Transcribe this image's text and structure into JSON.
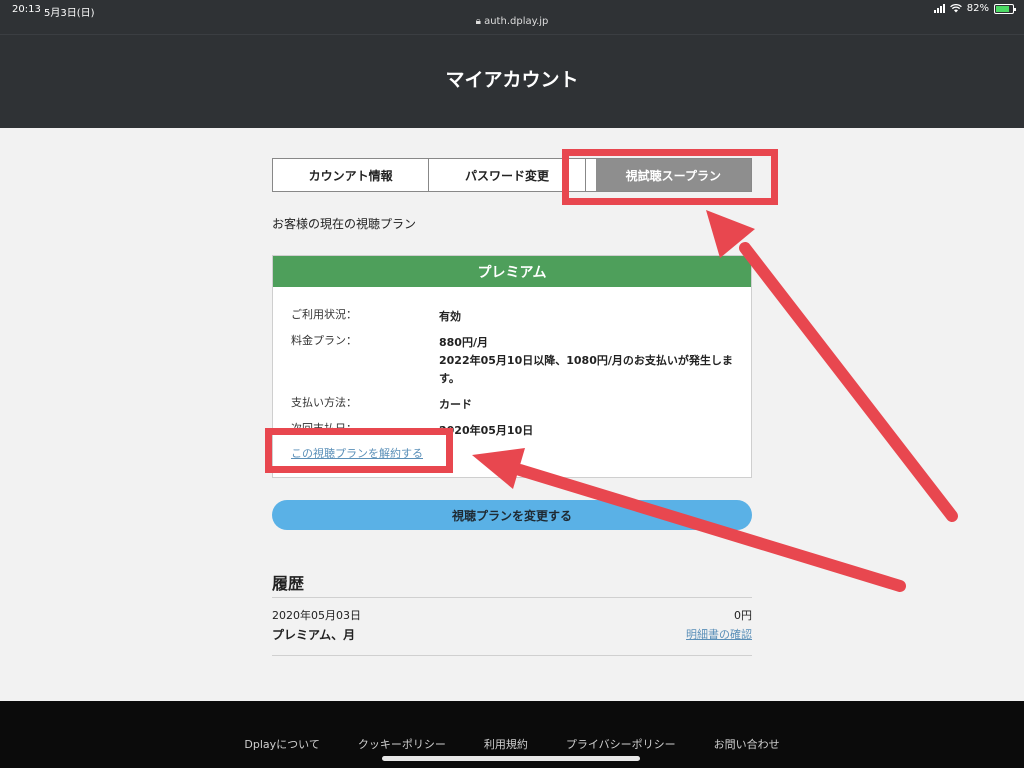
{
  "status_bar": {
    "time": "20:13",
    "date": "5月3日(日)",
    "url": "auth.dplay.jp",
    "battery_percent": "82%",
    "battery_level": 0.82
  },
  "header": {
    "title": "マイアカウント"
  },
  "tabs": [
    {
      "label": "カウンアト情報",
      "active": false
    },
    {
      "label": "パスワード変更",
      "active": false
    },
    {
      "label": "視試聴スープラン",
      "active": true
    }
  ],
  "plan_caption": "お客様の現在の視聴プラン",
  "plan_card": {
    "title": "プレミアム",
    "rows": [
      {
        "label": "ご利用状況：",
        "value": "有効"
      },
      {
        "label": "料金プラン：",
        "value": "880円/月",
        "note": "2022年05月10日以降、1080円/月のお支払いが発生します。"
      },
      {
        "label": "支払い方法：",
        "value": "カード"
      },
      {
        "label": "次回支払日：",
        "value": "2020年05月10日"
      }
    ],
    "cancel_link": "この視聴プランを解約する"
  },
  "change_button": "視聴プランを変更する",
  "history": {
    "title": "履歴",
    "date": "2020年05月03日",
    "amount": "0円",
    "plan": "プレミアム、月",
    "link": "明細書の確認"
  },
  "footer": {
    "links": [
      "Dplayについて",
      "クッキーポリシー",
      "利用規約",
      "プライバシーポリシー",
      "お問い合わせ"
    ]
  },
  "colors": {
    "highlight": "#e8474f",
    "plan_header": "#4e9f5b",
    "button": "#5ab1e6",
    "link": "#5a8fb8"
  }
}
